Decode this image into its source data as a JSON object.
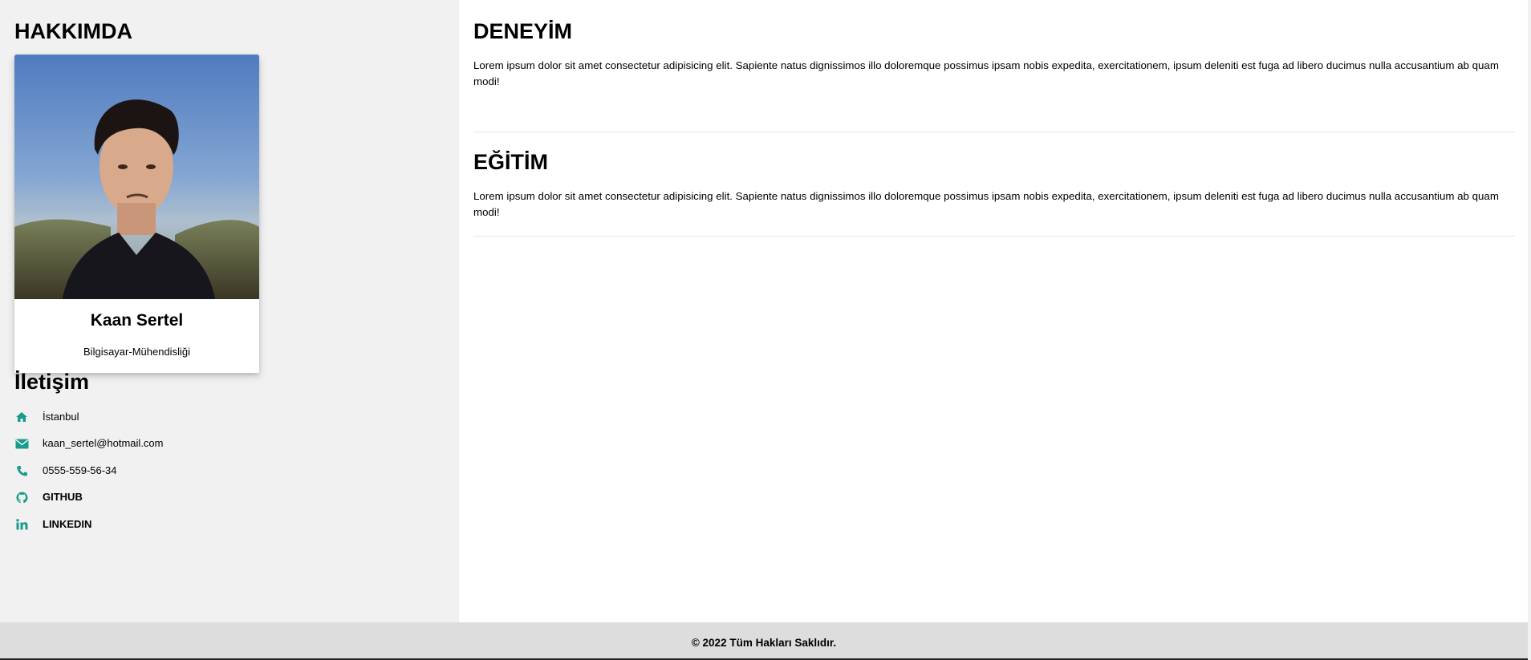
{
  "sidebar": {
    "about_heading": "HAKKIMDA",
    "profile": {
      "name": "Kaan Sertel",
      "title": "Bilgisayar-Mühendisliği"
    },
    "contact_heading": "İletişim",
    "contact": [
      {
        "icon": "home-icon",
        "text": "İstanbul"
      },
      {
        "icon": "envelope-icon",
        "text": "kaan_sertel@hotmail.com"
      },
      {
        "icon": "phone-icon",
        "text": "0555-559-56-34"
      },
      {
        "icon": "github-icon",
        "text": "GITHUB"
      },
      {
        "icon": "linkedin-icon",
        "text": "LINKEDIN"
      }
    ]
  },
  "main": {
    "sections": [
      {
        "heading": "DENEYİM",
        "text": "Lorem ipsum dolor sit amet consectetur adipisicing elit. Sapiente natus dignissimos illo doloremque possimus ipsam nobis expedita, exercitationem, ipsum deleniti est fuga ad libero ducimus nulla accusantium ab quam modi!"
      },
      {
        "heading": "EĞİTİM",
        "text": "Lorem ipsum dolor sit amet consectetur adipisicing elit. Sapiente natus dignissimos illo doloremque possimus ipsam nobis expedita, exercitationem, ipsum deleniti est fuga ad libero ducimus nulla accusantium ab quam modi!"
      }
    ]
  },
  "footer": {
    "text": "© 2022 Tüm Hakları Saklıdır."
  },
  "colors": {
    "accent": "#1a9b8c",
    "sidebar_bg": "#f1f1f1",
    "footer_bg": "#dddddd"
  }
}
